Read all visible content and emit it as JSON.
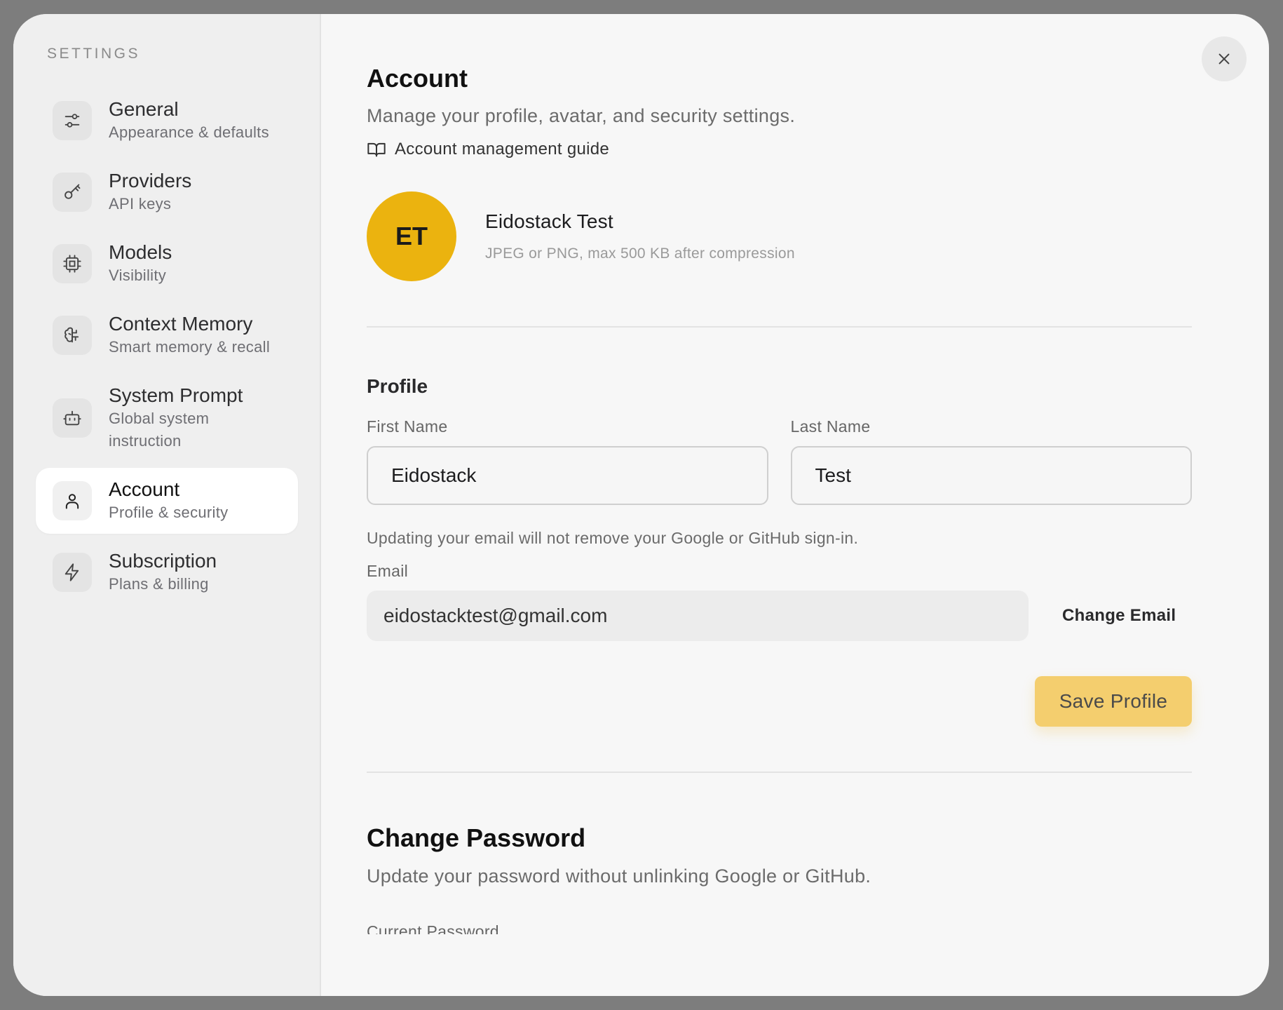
{
  "sidebar": {
    "heading": "SETTINGS",
    "items": [
      {
        "title": "General",
        "subtitle": "Appearance & defaults",
        "icon": "sliders-icon"
      },
      {
        "title": "Providers",
        "subtitle": "API keys",
        "icon": "key-icon"
      },
      {
        "title": "Models",
        "subtitle": "Visibility",
        "icon": "cpu-icon"
      },
      {
        "title": "Context Memory",
        "subtitle": "Smart memory & recall",
        "icon": "brain-icon"
      },
      {
        "title": "System Prompt",
        "subtitle": "Global system instruction",
        "icon": "bot-icon"
      },
      {
        "title": "Account",
        "subtitle": "Profile & security",
        "icon": "user-icon",
        "active": true
      },
      {
        "title": "Subscription",
        "subtitle": "Plans & billing",
        "icon": "bolt-icon"
      }
    ]
  },
  "header": {
    "title": "Account",
    "description": "Manage your profile, avatar, and security settings.",
    "guide_link": "Account management guide"
  },
  "avatar": {
    "initials": "ET",
    "name": "Eidostack Test",
    "hint": "JPEG or PNG, max 500 KB after compression",
    "color": "#ebb30f"
  },
  "profile": {
    "section_title": "Profile",
    "first_name_label": "First Name",
    "first_name_value": "Eidostack",
    "last_name_label": "Last Name",
    "last_name_value": "Test",
    "email_note": "Updating your email will not remove your Google or GitHub sign-in.",
    "email_label": "Email",
    "email_value": "eidostacktest@gmail.com",
    "change_email_label": "Change Email",
    "save_label": "Save Profile"
  },
  "password": {
    "title": "Change Password",
    "description": "Update your password without unlinking Google or GitHub.",
    "current_label": "Current Password"
  }
}
